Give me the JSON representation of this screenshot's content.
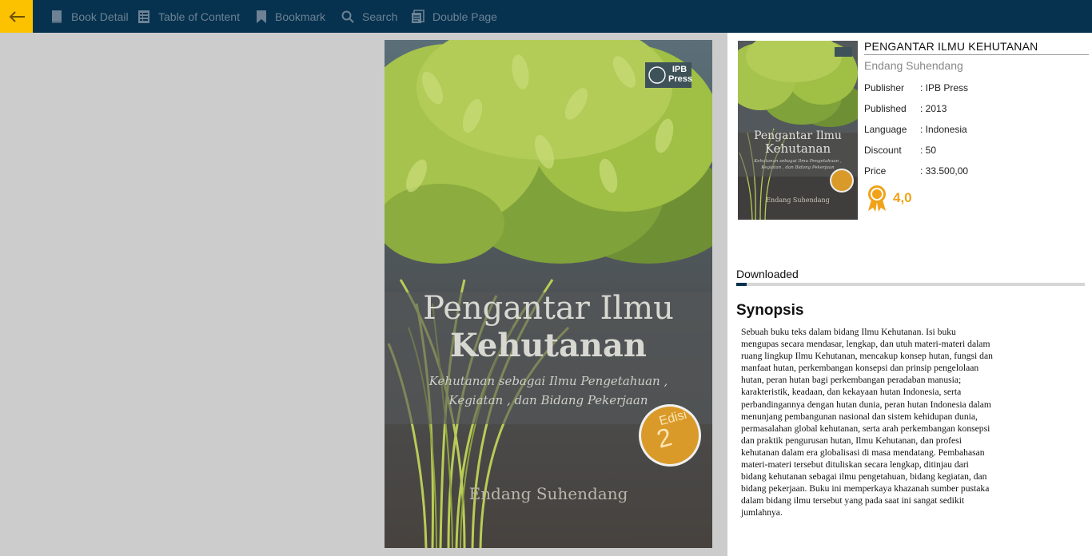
{
  "toolbar": {
    "book_detail": "Book Detail",
    "table_of_content": "Table of Content",
    "bookmark": "Bookmark",
    "search": "Search",
    "double_page": "Double Page"
  },
  "cover": {
    "publisher_logo": "IPB Press",
    "title_line1": "Pengantar Ilmu",
    "title_line2": "Kehutanan",
    "subtitle_line1": "Kehutanan sebagai Ilmu Pengetahuan ,",
    "subtitle_line2": "Kegiatan , dan Bidang Pekerjaan",
    "edition_word": "Edisi",
    "edition_number": "2",
    "author": "Endang Suhendang"
  },
  "book": {
    "title": "PENGANTAR ILMU KEHUTANAN",
    "author": "Endang Suhendang",
    "details": [
      {
        "label": "Publisher",
        "value": ": IPB Press"
      },
      {
        "label": "Published",
        "value": ": 2013"
      },
      {
        "label": "Language",
        "value": ": Indonesia"
      },
      {
        "label": "Discount",
        "value": ": 50"
      },
      {
        "label": "Price",
        "value": ": 33.500,00"
      }
    ],
    "rating": "4,0"
  },
  "download": {
    "label": "Downloaded",
    "progress": 0.03
  },
  "synopsis": {
    "heading": "Synopsis",
    "text": "Sebuah buku teks dalam bidang Ilmu Kehutanan. Isi buku mengupas secara mendasar, lengkap, dan utuh materi-materi dalam ruang lingkup Ilmu Kehutanan, mencakup konsep hutan, fungsi dan manfaat hutan, perkembangan konsepsi dan prinsip pengelolaan hutan, peran hutan bagi perkembangan peradaban manusia; karakteristik, keadaan, dan kekayaan hutan Indonesia, serta perbandingannya dengan hutan dunia, peran hutan Indonesia dalam menunjang pembangunan nasional dan sistem kehidupan dunia, permasalahan global kehutanan, serta arah perkembangan konsepsi dan praktik pengurusan hutan, Ilmu Kehutanan, dan profesi kehutanan dalam era globalisasi di masa mendatang. Pembahasan materi-materi tersebut dituliskan secara lengkap, ditinjau dari bidang kehutanan sebagai ilmu pengetahuan, bidang kegiatan, dan bidang pekerjaan. Buku ini memperkaya khazanah sumber pustaka dalam bidang ilmu tersebut yang pada saat ini sangat sedikit jumlahnya."
  },
  "colors": {
    "topbar": "#06324f",
    "accent": "#fcc200",
    "rating": "#f0a31a",
    "leaf_green": "#9fbf45"
  }
}
